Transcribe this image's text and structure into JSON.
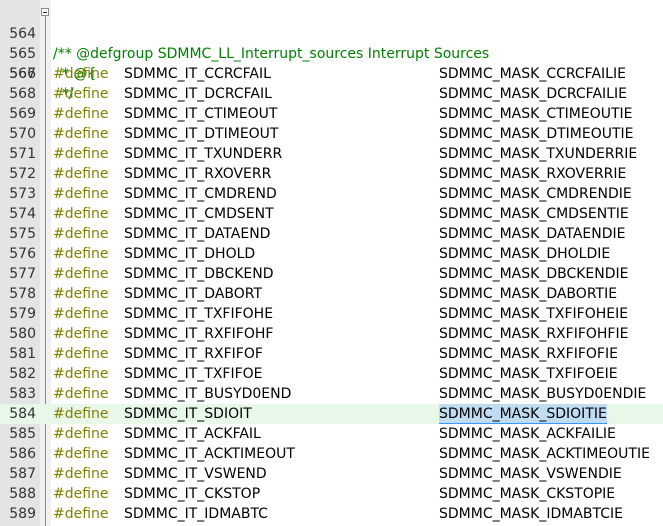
{
  "editor": {
    "header_lines": [
      {
        "num": "564",
        "text": "/** @defgroup SDMMC_LL_Interrupt_sources Interrupt Sources"
      },
      {
        "num": "565",
        "text": "  * @{"
      },
      {
        "num": "566",
        "text": "  */"
      }
    ],
    "define_keyword": "#define",
    "define_lines": [
      {
        "num": "567",
        "name": "SDMMC_IT_CCRCFAIL",
        "value": "SDMMC_MASK_CCRCFAILIE"
      },
      {
        "num": "568",
        "name": "SDMMC_IT_DCRCFAIL",
        "value": "SDMMC_MASK_DCRCFAILIE"
      },
      {
        "num": "569",
        "name": "SDMMC_IT_CTIMEOUT",
        "value": "SDMMC_MASK_CTIMEOUTIE"
      },
      {
        "num": "570",
        "name": "SDMMC_IT_DTIMEOUT",
        "value": "SDMMC_MASK_DTIMEOUTIE"
      },
      {
        "num": "571",
        "name": "SDMMC_IT_TXUNDERR",
        "value": "SDMMC_MASK_TXUNDERRIE"
      },
      {
        "num": "572",
        "name": "SDMMC_IT_RXOVERR",
        "value": "SDMMC_MASK_RXOVERRIE"
      },
      {
        "num": "573",
        "name": "SDMMC_IT_CMDREND",
        "value": "SDMMC_MASK_CMDRENDIE"
      },
      {
        "num": "574",
        "name": "SDMMC_IT_CMDSENT",
        "value": "SDMMC_MASK_CMDSENTIE"
      },
      {
        "num": "575",
        "name": "SDMMC_IT_DATAEND",
        "value": "SDMMC_MASK_DATAENDIE"
      },
      {
        "num": "576",
        "name": "SDMMC_IT_DHOLD",
        "value": "SDMMC_MASK_DHOLDIE"
      },
      {
        "num": "577",
        "name": "SDMMC_IT_DBCKEND",
        "value": "SDMMC_MASK_DBCKENDIE"
      },
      {
        "num": "578",
        "name": "SDMMC_IT_DABORT",
        "value": "SDMMC_MASK_DABORTIE"
      },
      {
        "num": "579",
        "name": "SDMMC_IT_TXFIFOHE",
        "value": "SDMMC_MASK_TXFIFOHEIE"
      },
      {
        "num": "580",
        "name": "SDMMC_IT_RXFIFOHF",
        "value": "SDMMC_MASK_RXFIFOHFIE"
      },
      {
        "num": "581",
        "name": "SDMMC_IT_RXFIFOF",
        "value": "SDMMC_MASK_RXFIFOFIE"
      },
      {
        "num": "582",
        "name": "SDMMC_IT_TXFIFOE",
        "value": "SDMMC_MASK_TXFIFOEIE"
      },
      {
        "num": "583",
        "name": "SDMMC_IT_BUSYD0END",
        "value": "SDMMC_MASK_BUSYD0ENDIE"
      },
      {
        "num": "584",
        "name": "SDMMC_IT_SDIOIT",
        "value": "SDMMC_MASK_SDIOITIE",
        "current": true,
        "selected": true
      },
      {
        "num": "585",
        "name": "SDMMC_IT_ACKFAIL",
        "value": "SDMMC_MASK_ACKFAILIE"
      },
      {
        "num": "586",
        "name": "SDMMC_IT_ACKTIMEOUT",
        "value": "SDMMC_MASK_ACKTIMEOUTIE"
      },
      {
        "num": "587",
        "name": "SDMMC_IT_VSWEND",
        "value": "SDMMC_MASK_VSWENDIE"
      },
      {
        "num": "588",
        "name": "SDMMC_IT_CKSTOP",
        "value": "SDMMC_MASK_CKSTOPIE"
      },
      {
        "num": "589",
        "name": "SDMMC_IT_IDMABTC",
        "value": "SDMMC_MASK_IDMABTCIE"
      }
    ],
    "colors": {
      "keyword": "#808000",
      "comment": "#008000",
      "current_line": "#e8f8e8",
      "selection": "#c0dcf3",
      "gutter": "#e4e4e4"
    }
  }
}
